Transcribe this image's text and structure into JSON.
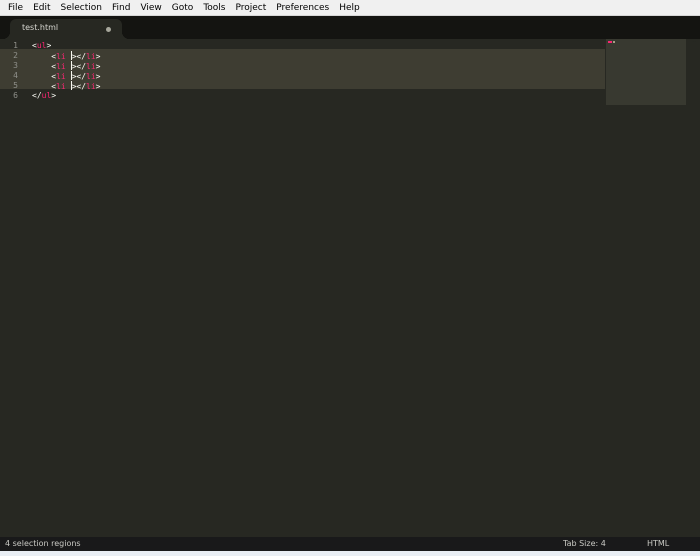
{
  "menubar": {
    "items": [
      "File",
      "Edit",
      "Selection",
      "Find",
      "View",
      "Goto",
      "Tools",
      "Project",
      "Preferences",
      "Help"
    ]
  },
  "tabs": [
    {
      "label": "test.html",
      "dirty": true
    }
  ],
  "editor": {
    "line_numbers": [
      "1",
      "2",
      "3",
      "4",
      "5",
      "6"
    ],
    "lines": [
      {
        "indent": "",
        "open": "<",
        "tag": "ul",
        "close": ">"
      },
      {
        "indent": "    ",
        "open": "<",
        "tag": "li",
        "mid": " ",
        "has_caret": true,
        "mid2": "></",
        "tag2": "li",
        "close": ">"
      },
      {
        "indent": "    ",
        "open": "<",
        "tag": "li",
        "mid": " ",
        "has_caret": true,
        "mid2": "></",
        "tag2": "li",
        "close": ">"
      },
      {
        "indent": "    ",
        "open": "<",
        "tag": "li",
        "mid": " ",
        "has_caret": true,
        "mid2": "></",
        "tag2": "li",
        "close": ">"
      },
      {
        "indent": "    ",
        "open": "<",
        "tag": "li",
        "mid": " ",
        "has_caret": true,
        "mid2": "></",
        "tag2": "li",
        "close": ">"
      },
      {
        "indent": "",
        "open": "</",
        "tag": "ul",
        "close": ">"
      }
    ],
    "highlighted_lines": [
      2,
      3,
      4,
      5
    ]
  },
  "colors": {
    "background": "#272822",
    "tag": "#f92672",
    "punctuation": "#f8f8f2",
    "line_highlight": "#3e3d32",
    "gutter_text": "#8f908a"
  },
  "statusbar": {
    "selection_info": "4 selection regions",
    "tab_size": "Tab Size: 4",
    "syntax": "HTML"
  }
}
